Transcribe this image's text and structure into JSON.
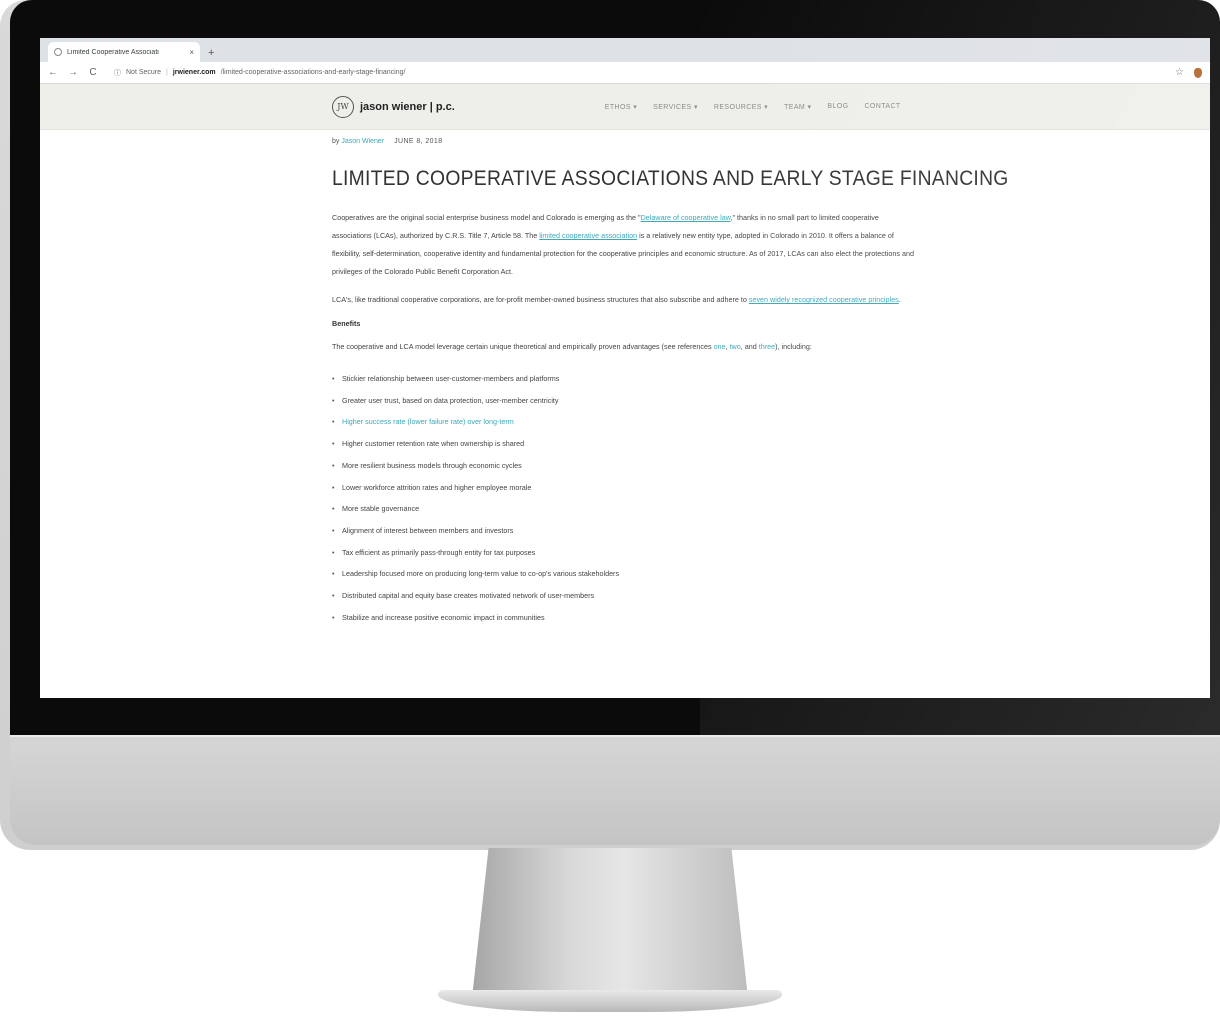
{
  "browser": {
    "tab_title": "Limited Cooperative Associati",
    "tab_close": "×",
    "new_tab": "+",
    "security": "Not Secure",
    "url_domain": "jrwiener.com",
    "url_path": "/limited-cooperative-associations-and-early-stage-financing/",
    "icons": [
      "back-icon",
      "forward-icon",
      "reload-icon",
      "info-icon",
      "star-icon",
      "extension-icon"
    ]
  },
  "site": {
    "logo_mark": "JW",
    "logo_text": "jason wiener | p.c.",
    "nav": [
      {
        "label": "ETHOS ▾"
      },
      {
        "label": "SERVICES ▾"
      },
      {
        "label": "RESOURCES ▾"
      },
      {
        "label": "TEAM ▾"
      },
      {
        "label": "BLOG"
      },
      {
        "label": "CONTACT"
      }
    ]
  },
  "article": {
    "by": "by",
    "author": "Jason Wiener",
    "date": "JUNE 8, 2018",
    "title": "LIMITED COOPERATIVE ASSOCIATIONS AND EARLY STAGE FINANCING",
    "p1": {
      "t1": "Cooperatives are the original social enterprise business model and Colorado is emerging as the \"",
      "l1": "Delaware of cooperative law",
      "t2": ",\" thanks in no small part to limited cooperative associations (LCAs), authorized by C.R.S. Title 7, Article 58. The ",
      "l2": "limited cooperative association",
      "t3": " is a relatively new entity type, adopted in Colorado in 2010. It offers a balance of flexibility, self-determination, cooperative identity and fundamental protection for the cooperative principles and economic structure. As of 2017, LCAs can also elect the protections and privileges of the Colorado Public Benefit Corporation Act."
    },
    "p2": {
      "t1": "LCA's, like traditional cooperative corporations, are for-profit member-owned business structures that also subscribe and adhere to ",
      "l1": "seven widely recognized cooperative principles",
      "t2": "."
    },
    "subhead": "Benefits",
    "p3": {
      "t1": "The cooperative and LCA model leverage certain unique theoretical and empirically proven advantages (see references ",
      "l1": "one",
      "t2": ", ",
      "l2": "two",
      "t3": ", and ",
      "l3": "three",
      "t4": "), including:"
    },
    "benefits": [
      "Stickier relationship between user-customer-members and platforms",
      "Greater user trust, based on data protection, user-member centricity",
      "Higher success rate (lower failure rate) over long-term",
      "Higher customer retention rate when ownership is shared",
      "More resilient business models through economic cycles",
      "Lower workforce attrition rates and higher employee morale",
      "More stable governance",
      "Alignment of interest between members and investors",
      "Tax efficient as primarily pass-through entity for tax purposes",
      "Leadership focused more on producing long-term value to co-op's various stakeholders",
      "Distributed capital and equity base creates motivated network of user-members",
      "Stabilize and increase positive economic impact in communities"
    ]
  }
}
